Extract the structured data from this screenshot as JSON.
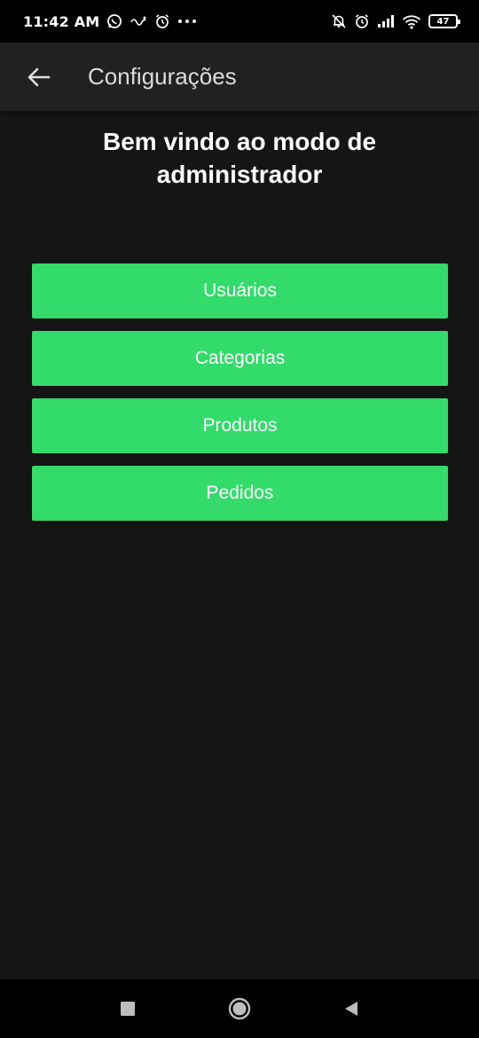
{
  "status_bar": {
    "time": "11:42 AM",
    "battery": "47",
    "icons_left": [
      "whatsapp-icon",
      "mobile-data-icon",
      "alarm-icon",
      "more-dots-icon"
    ],
    "icons_right": [
      "notifications-off-icon",
      "alarm-icon",
      "signal-icon",
      "wifi-icon",
      "battery-icon"
    ]
  },
  "app_bar": {
    "back_icon": "arrow-left-icon",
    "title": "Configurações"
  },
  "welcome": {
    "line1": "Bem vindo ao modo de",
    "line2": "administrador"
  },
  "menu": {
    "items": [
      {
        "label": "Usuários"
      },
      {
        "label": "Categorias"
      },
      {
        "label": "Produtos"
      },
      {
        "label": "Pedidos"
      }
    ]
  },
  "nav_bar": {
    "icons": [
      "recents-square-icon",
      "home-circle-icon",
      "back-triangle-icon"
    ]
  },
  "colors": {
    "background": "#151515",
    "app_bar": "#212121",
    "accent_green": "#33db6b",
    "status_bar": "#000000"
  }
}
